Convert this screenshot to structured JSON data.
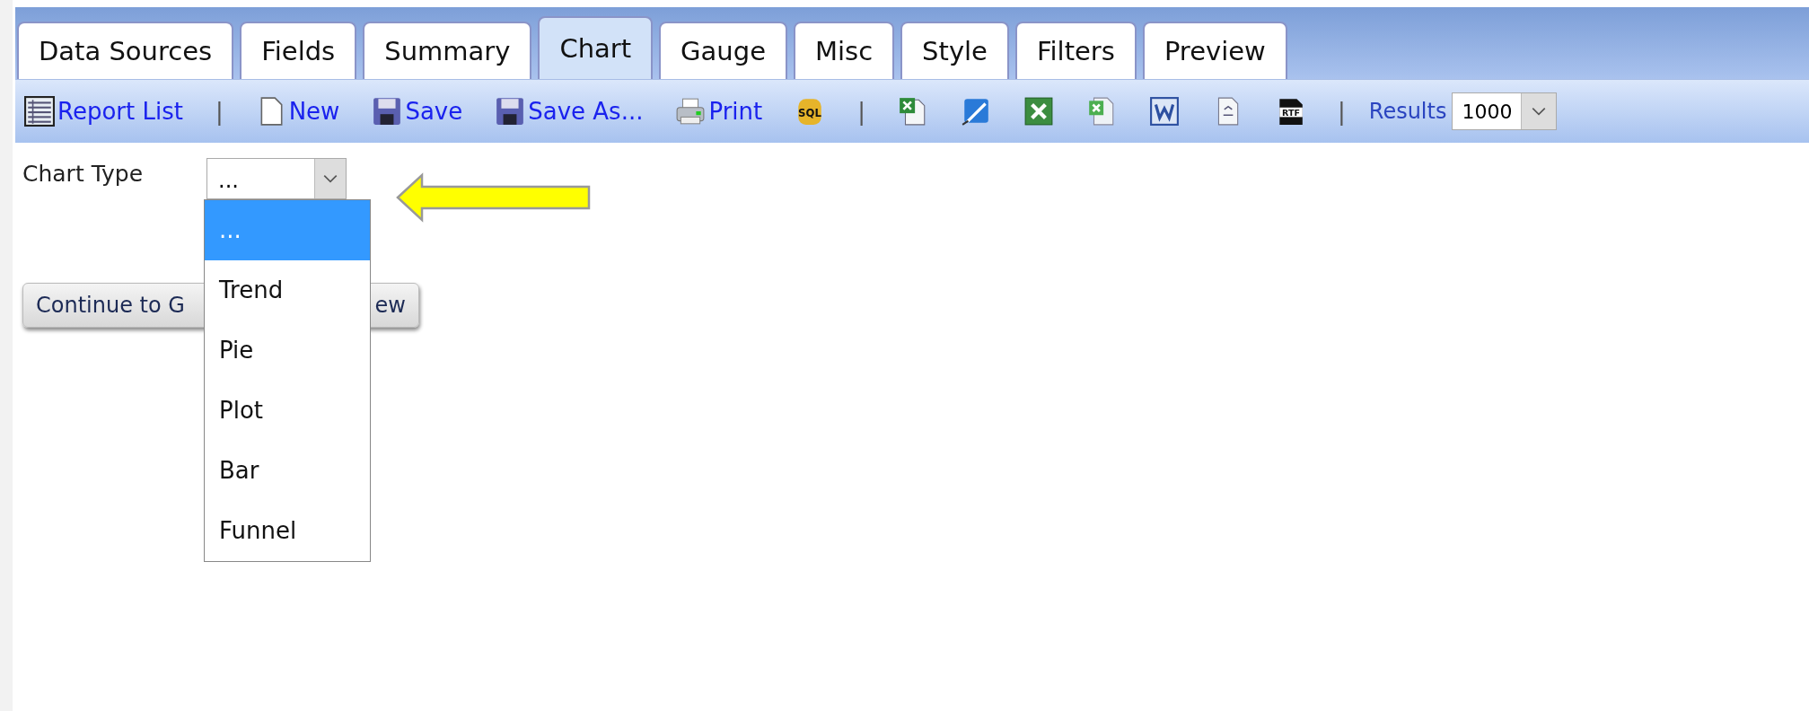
{
  "tabs": [
    {
      "label": "Data Sources",
      "selected": false
    },
    {
      "label": "Fields",
      "selected": false
    },
    {
      "label": "Summary",
      "selected": false
    },
    {
      "label": "Chart",
      "selected": true
    },
    {
      "label": "Gauge",
      "selected": false
    },
    {
      "label": "Misc",
      "selected": false
    },
    {
      "label": "Style",
      "selected": false
    },
    {
      "label": "Filters",
      "selected": false
    },
    {
      "label": "Preview",
      "selected": false
    }
  ],
  "toolbar": [
    {
      "kind": "link",
      "label": "Report List"
    },
    {
      "kind": "separator",
      "label": "|"
    },
    {
      "kind": "link",
      "label": "New"
    },
    {
      "kind": "link",
      "label": "Save"
    },
    {
      "kind": "link",
      "label": "Save As..."
    },
    {
      "kind": "link",
      "label": "Print"
    },
    {
      "kind": "icon",
      "text": "SQL"
    },
    {
      "kind": "separator",
      "label": "|"
    },
    {
      "kind": "icon"
    },
    {
      "kind": "icon"
    },
    {
      "kind": "icon"
    },
    {
      "kind": "icon"
    },
    {
      "kind": "icon"
    },
    {
      "kind": "icon"
    },
    {
      "kind": "icon",
      "text": "RTF"
    },
    {
      "kind": "separator",
      "label": "|"
    },
    {
      "kind": "results",
      "label": "Results",
      "value": "1000"
    }
  ],
  "chart_type": {
    "label": "Chart Type",
    "value": "...",
    "expanded": true,
    "options": [
      {
        "label": "...",
        "selected": true
      },
      {
        "label": "Trend",
        "selected": false
      },
      {
        "label": "Pie",
        "selected": false
      },
      {
        "label": "Plot",
        "selected": false
      },
      {
        "label": "Bar",
        "selected": false
      },
      {
        "label": "Funnel",
        "selected": false
      }
    ]
  },
  "continue_button": {
    "label_left": "Continue to G",
    "label_right": "ew"
  }
}
